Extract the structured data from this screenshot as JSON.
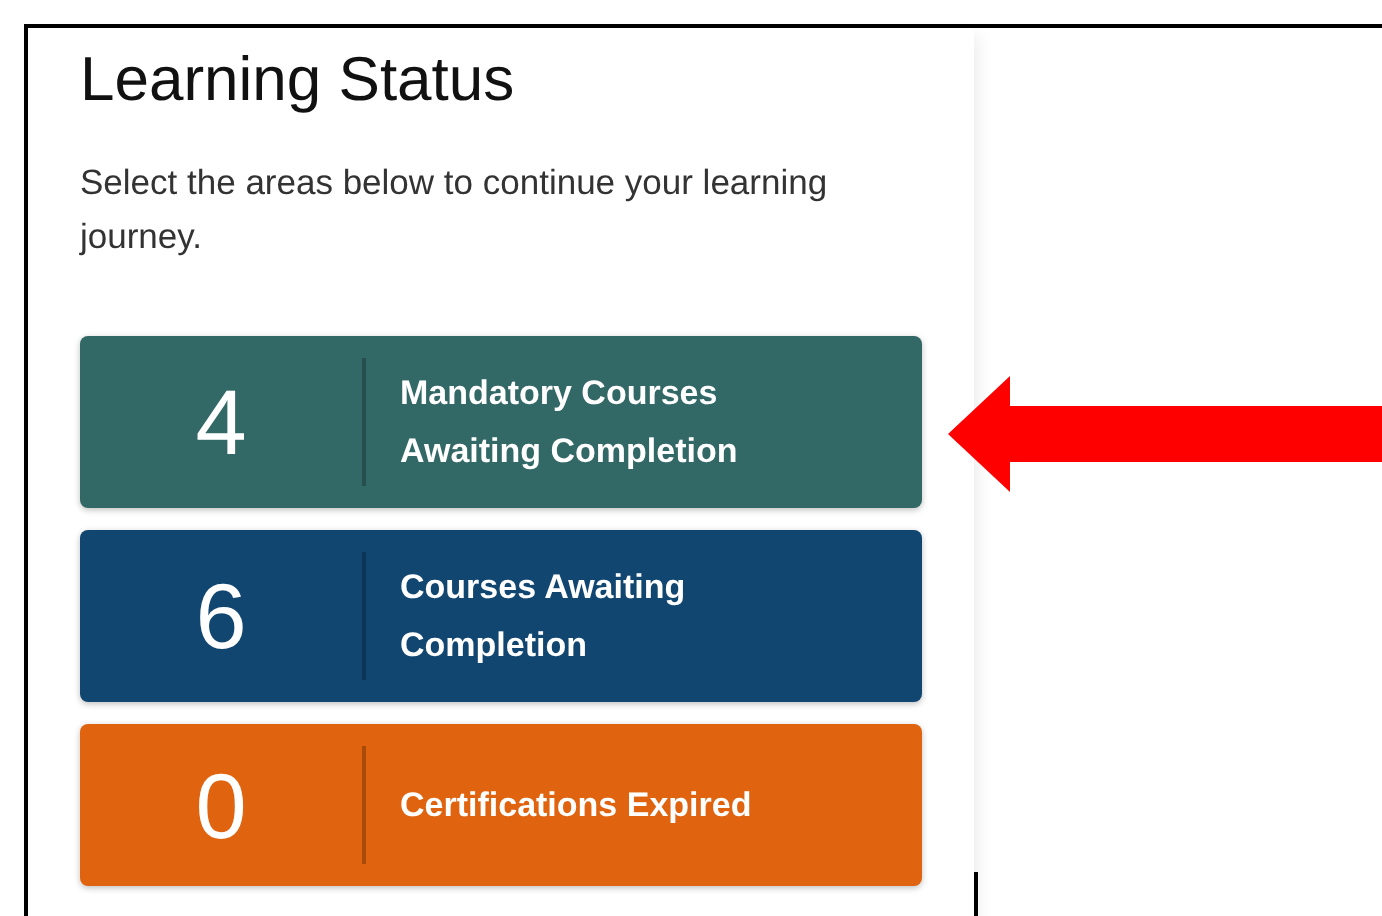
{
  "title": "Learning Status",
  "intro": "Select the areas below to continue your learning journey.",
  "cards": [
    {
      "count": "4",
      "label": "Mandatory Courses Awaiting Completion",
      "color": "#326866"
    },
    {
      "count": "6",
      "label": "Courses Awaiting Completion",
      "color": "#114670"
    },
    {
      "count": "0",
      "label": "Certifications Expired",
      "color": "#e0640f"
    }
  ]
}
